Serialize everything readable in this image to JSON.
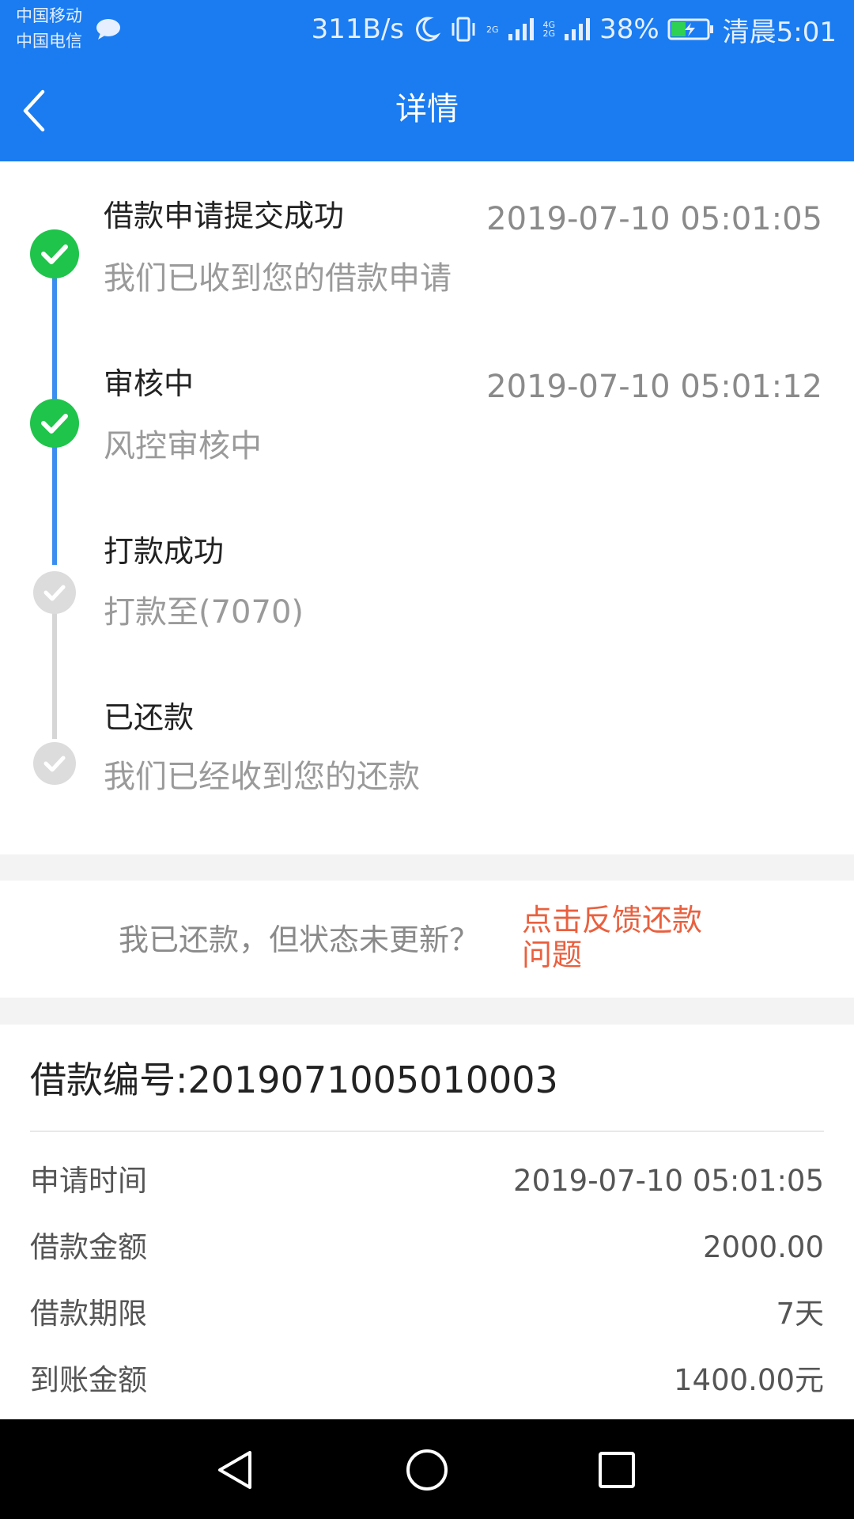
{
  "status_bar": {
    "carrier_1": "中国移动",
    "carrier_2": "中国电信",
    "speed": "311B/s",
    "net_2g": "2G",
    "net_4g": "4G",
    "net_2g_b": "2G",
    "battery": "38%",
    "time": "清晨5:01"
  },
  "header": {
    "title": "详情"
  },
  "timeline": [
    {
      "title": "借款申请提交成功",
      "time": "2019-07-10 05:01:05",
      "desc": "我们已收到您的借款申请",
      "done": true
    },
    {
      "title": "审核中",
      "time": "2019-07-10 05:01:12",
      "desc": "风控审核中",
      "done": true
    },
    {
      "title": "打款成功",
      "time": "",
      "desc": "打款至(7070)",
      "done": false
    },
    {
      "title": "已还款",
      "time": "",
      "desc": "我们已经收到您的还款",
      "done": false
    }
  ],
  "feedback": {
    "text": "我已还款，但状态未更新？",
    "link": "点击反馈还款问题"
  },
  "loan": {
    "number_label": "借款编号:2019071005010003",
    "rows": [
      {
        "label": "申请时间",
        "value": "2019-07-10 05:01:05"
      },
      {
        "label": "借款金额",
        "value": "2000.00"
      },
      {
        "label": "借款期限",
        "value": "7天"
      },
      {
        "label": "到账金额",
        "value": "1400.00元"
      }
    ]
  },
  "colors": {
    "brand": "#1a7cf0",
    "done": "#1fc44a",
    "pending": "#dcdcdc",
    "link": "#e9603f"
  }
}
